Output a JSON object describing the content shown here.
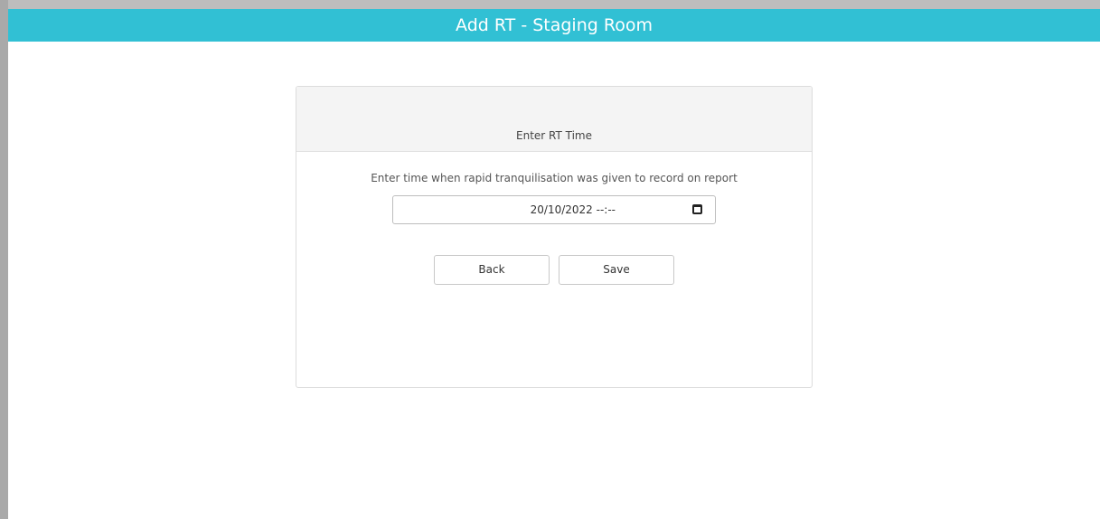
{
  "window": {
    "title": "Add RT - Staging Room"
  },
  "card": {
    "header": "Enter RT Time",
    "instruction": "Enter time when rapid tranquilisation was given to record on report",
    "datetime": {
      "value": "20/10/2022 --:--",
      "icon": "calendar-icon"
    },
    "buttons": {
      "back_label": "Back",
      "save_label": "Save"
    }
  },
  "colors": {
    "titlebar": "#31c0d4",
    "card_header_bg": "#f4f4f4"
  }
}
